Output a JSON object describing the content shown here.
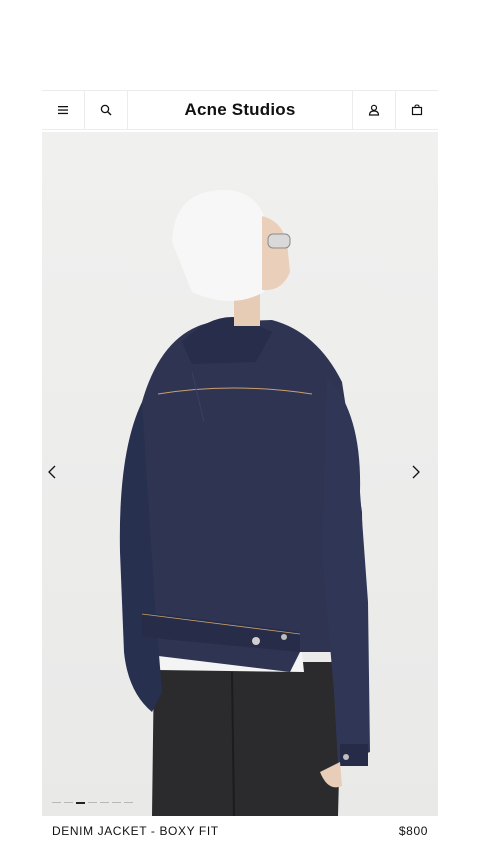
{
  "header": {
    "brand": "Acne Studios",
    "menu_icon": "hamburger-menu-icon",
    "search_icon": "search-icon",
    "account_icon": "user-icon",
    "bag_icon": "shopping-bag-icon"
  },
  "gallery": {
    "image_alt": "Denim jacket - boxy fit, back view on model",
    "prev_icon": "chevron-left-icon",
    "next_icon": "chevron-right-icon",
    "slide_count": 7,
    "active_slide": 4
  },
  "product": {
    "name": "DENIM JACKET - BOXY FIT",
    "price": "$800"
  },
  "colors": {
    "denim": "#2c3350",
    "background": "#ebebea",
    "text": "#111111"
  }
}
